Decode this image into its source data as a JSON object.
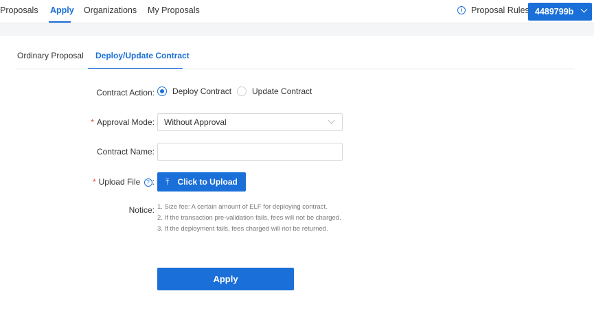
{
  "nav": {
    "items": [
      {
        "label": "Proposals"
      },
      {
        "label": "Apply"
      },
      {
        "label": "Organizations"
      },
      {
        "label": "My Proposals"
      }
    ],
    "active": "Apply",
    "rules_label": "Proposal Rules",
    "rules_icon": "info-icon",
    "account_label": "4489799b"
  },
  "subtabs": [
    {
      "label": "Ordinary Proposal"
    },
    {
      "label": "Deploy/Update Contract"
    }
  ],
  "form": {
    "contract_action": {
      "label": "Contract Action",
      "options": [
        "Deploy Contract",
        "Update Contract"
      ],
      "selected": "Deploy Contract"
    },
    "approval_mode": {
      "label": "Approval Mode",
      "required": "*",
      "value": "Without Approval"
    },
    "contract_name": {
      "label": "Contract Name",
      "value": "",
      "placeholder": ""
    },
    "upload_file": {
      "label": "Upload File",
      "required": "*",
      "button_label": "Click to Upload",
      "button_icon": "upload-icon"
    },
    "notice": {
      "label": "Notice",
      "lines": [
        "1. Size fee: A certain amount of ELF for deploying contract.",
        "2. If the transaction pre-validation fails, fees will not be charged.",
        "3. If the deployment fails, fees charged will not be returned."
      ]
    },
    "submit_label": "Apply"
  },
  "colors": {
    "accent": "#1a6fd8",
    "required": "#e5453b"
  }
}
